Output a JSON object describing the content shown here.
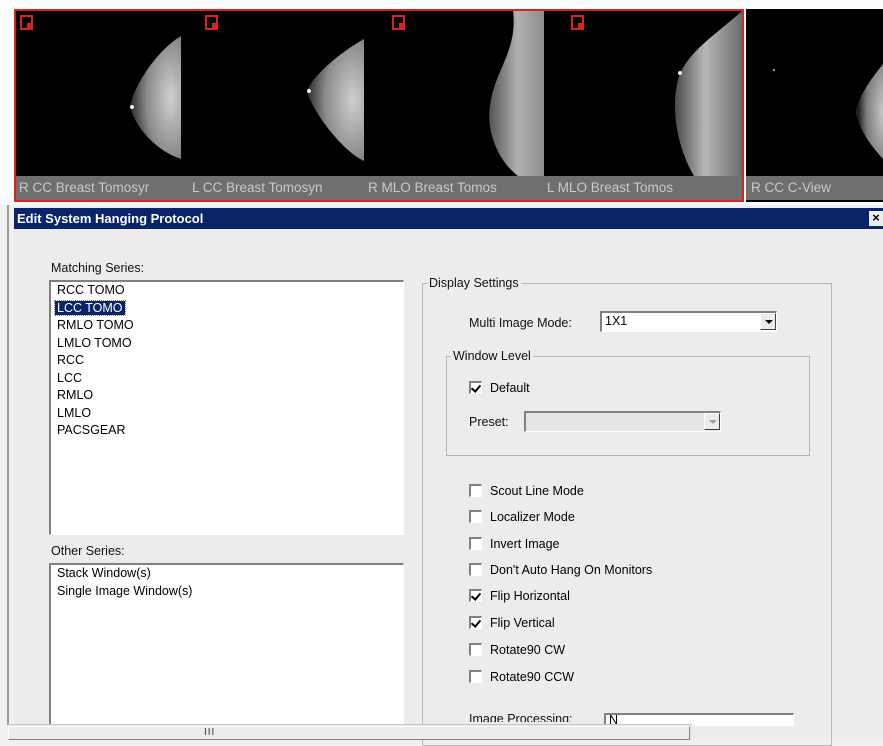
{
  "viewer": {
    "viewports": [
      {
        "caption": "R CC Breast Tomosyr"
      },
      {
        "caption": "L CC Breast Tomosyn"
      },
      {
        "caption": "R MLO Breast Tomos"
      },
      {
        "caption": "L MLO Breast Tomos"
      },
      {
        "caption": "R CC C-View"
      }
    ]
  },
  "dialog": {
    "title": "Edit System Hanging Protocol",
    "close_label": "×",
    "matching_series": {
      "label": "Matching Series:",
      "items": [
        "RCC TOMO",
        "LCC TOMO",
        "RMLO TOMO",
        "LMLO TOMO",
        "RCC",
        "LCC",
        "RMLO",
        "LMLO",
        "PACSGEAR"
      ],
      "selected": "LCC TOMO"
    },
    "other_series": {
      "label": "Other Series:",
      "items": [
        "Stack Window(s)",
        "Single Image Window(s)"
      ]
    },
    "display_settings": {
      "legend": "Display Settings",
      "multi_image_mode_label": "Multi Image Mode:",
      "multi_image_mode_value": "1X1",
      "window_level": {
        "legend": "Window Level",
        "default_label": "Default",
        "default_checked": true,
        "preset_label": "Preset:",
        "preset_value": ""
      },
      "options": [
        {
          "label": "Scout Line Mode",
          "checked": false
        },
        {
          "label": "Localizer Mode",
          "checked": false
        },
        {
          "label": "Invert Image",
          "checked": false
        },
        {
          "label": "Don't Auto Hang On Monitors",
          "checked": false
        },
        {
          "label": "Flip Horizontal",
          "checked": true
        },
        {
          "label": "Flip Vertical",
          "checked": true
        },
        {
          "label": "Rotate90 CW",
          "checked": false
        },
        {
          "label": "Rotate90 CCW",
          "checked": false
        }
      ],
      "image_processing_label": "Image Processing:",
      "image_processing_value": "N"
    }
  },
  "scrollbar": {
    "grip": "III"
  }
}
